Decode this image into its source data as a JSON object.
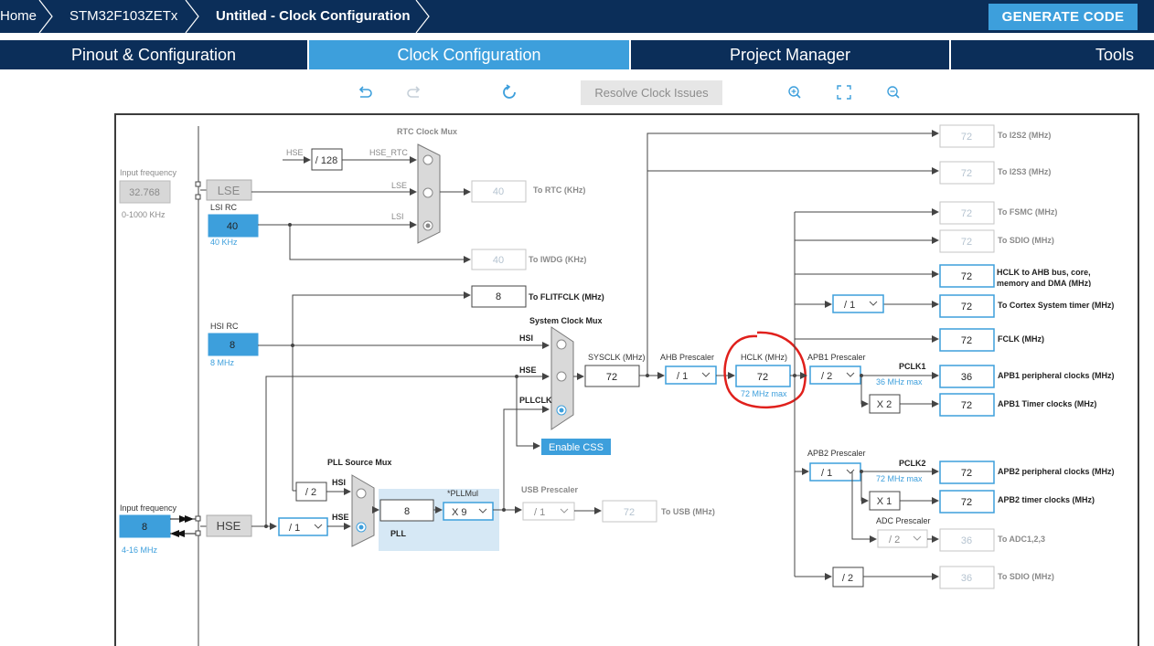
{
  "header": {
    "breadcrumbs": [
      "Home",
      "STM32F103ZETx",
      "Untitled - Clock Configuration"
    ],
    "generate_label": "GENERATE CODE"
  },
  "tabs": [
    "Pinout & Configuration",
    "Clock Configuration",
    "Project Manager",
    "Tools"
  ],
  "toolbar": {
    "resolve_label": "Resolve Clock Issues",
    "icons": [
      "undo-icon",
      "redo-icon",
      "reset-icon",
      "zoom-in-icon",
      "fit-screen-icon",
      "zoom-out-icon"
    ]
  },
  "colors": {
    "navy": "#0b2e59",
    "accent": "#3d9fdc",
    "annotation": "#e0201c"
  },
  "diagram": {
    "lse_in": {
      "label": "Input frequency",
      "value": "32.768",
      "range": "0-1000 KHz"
    },
    "lse": "LSE",
    "lsi": {
      "label": "LSI RC",
      "value": "40",
      "sub": "40 KHz"
    },
    "rtc_mux": {
      "title": "RTC Clock Mux",
      "hse": "HSE",
      "div": "/ 128",
      "hse_rtc": "HSE_RTC",
      "lse": "LSE",
      "lsi": "LSI"
    },
    "to_rtc": {
      "value": "40",
      "label": "To RTC (KHz)"
    },
    "to_iwdg": {
      "value": "40",
      "label": "To IWDG (KHz)"
    },
    "flitf": {
      "value": "8",
      "label": "To FLITFCLK (MHz)"
    },
    "hsi": {
      "label": "HSI RC",
      "value": "8",
      "sub": "8 MHz"
    },
    "sysmux": {
      "title": "System Clock Mux",
      "hsi": "HSI",
      "hse": "HSE",
      "pllclk": "PLLCLK"
    },
    "enable_css": "Enable CSS",
    "sysclk": {
      "label": "SYSCLK (MHz)",
      "value": "72"
    },
    "ahb": {
      "label": "AHB Prescaler",
      "value": "/ 1"
    },
    "hclk": {
      "label": "HCLK (MHz)",
      "value": "72",
      "max": "72 MHz max"
    },
    "apb1": {
      "label": "APB1 Prescaler",
      "value": "/ 2",
      "pclk": "PCLK1",
      "max": "36 MHz max",
      "timer_mult": "X 2"
    },
    "apb2": {
      "label": "APB2 Prescaler",
      "value": "/ 1",
      "pclk": "PCLK2",
      "max": "72 MHz max",
      "timer_mult": "X 1"
    },
    "adc": {
      "label": "ADC Prescaler",
      "value": "/ 2"
    },
    "cortex_div": "/ 1",
    "sdio_div": "/ 2",
    "hse_in": {
      "label": "Input frequency",
      "value": "8",
      "range": "4-16 MHz"
    },
    "hse": "HSE",
    "hse_prediv": "/ 1",
    "pll_src": {
      "title": "PLL Source Mux",
      "div": "/ 2",
      "hsi": "HSI",
      "hse": "HSE"
    },
    "pll": {
      "value": "8",
      "mul_label": "*PLLMul",
      "mul": "X 9",
      "label": "PLL"
    },
    "usb": {
      "label": "USB Prescaler",
      "value": "/ 1",
      "out": "72",
      "out_label": "To USB (MHz)"
    },
    "outputs": [
      {
        "value": "72",
        "label": "To I2S2 (MHz)",
        "enabled": false
      },
      {
        "value": "72",
        "label": "To I2S3 (MHz)",
        "enabled": false
      },
      {
        "value": "72",
        "label": "To FSMC (MHz)",
        "enabled": false
      },
      {
        "value": "72",
        "label": "To SDIO (MHz)",
        "enabled": false
      },
      {
        "value": "72",
        "label": "HCLK to AHB bus, core, memory and DMA (MHz)",
        "enabled": true
      },
      {
        "value": "72",
        "label": "To Cortex System timer (MHz)",
        "enabled": true
      },
      {
        "value": "72",
        "label": "FCLK (MHz)",
        "enabled": true
      },
      {
        "value": "36",
        "label": "APB1 peripheral clocks (MHz)",
        "enabled": true
      },
      {
        "value": "72",
        "label": "APB1 Timer clocks (MHz)",
        "enabled": true
      },
      {
        "value": "72",
        "label": "APB2 peripheral clocks (MHz)",
        "enabled": true
      },
      {
        "value": "72",
        "label": "APB2 timer clocks (MHz)",
        "enabled": true
      },
      {
        "value": "36",
        "label": "To ADC1,2,3",
        "enabled": false
      },
      {
        "value": "36",
        "label": "To SDIO (MHz)",
        "enabled": false
      }
    ]
  }
}
